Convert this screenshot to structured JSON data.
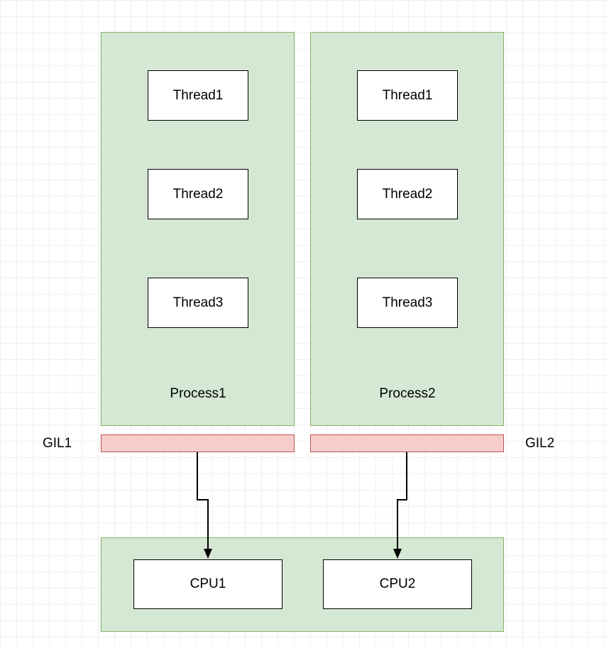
{
  "processes": [
    {
      "label": "Process1",
      "threads": [
        "Thread1",
        "Thread2",
        "Thread3"
      ]
    },
    {
      "label": "Process2",
      "threads": [
        "Thread1",
        "Thread2",
        "Thread3"
      ]
    }
  ],
  "gils": [
    {
      "label": "GIL1"
    },
    {
      "label": "GIL2"
    }
  ],
  "cpus": [
    "CPU1",
    "CPU2"
  ]
}
